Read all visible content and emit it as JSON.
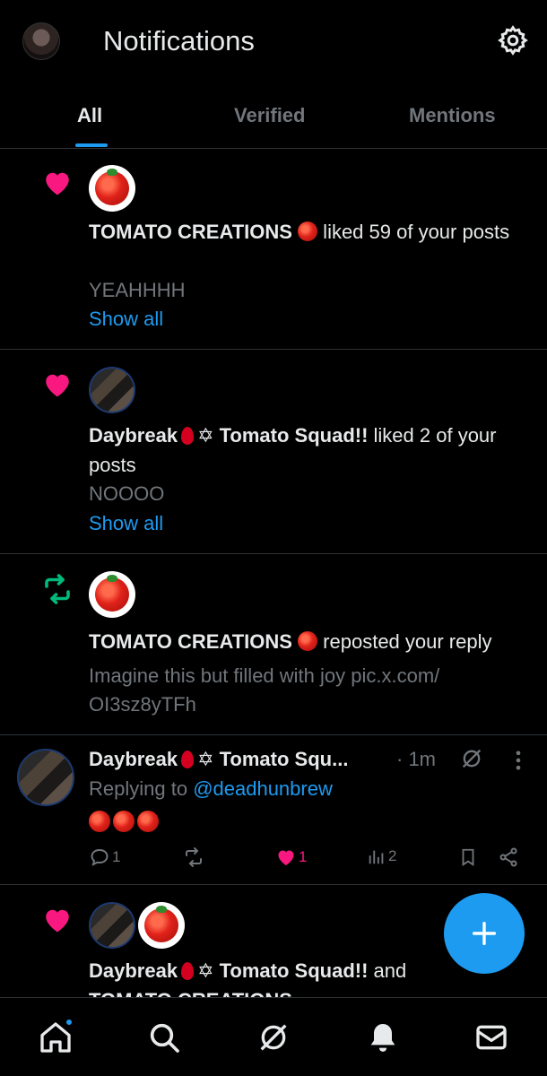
{
  "header": {
    "title": "Notifications",
    "avatar_icon": "profile-avatar",
    "settings_icon": "gear-icon"
  },
  "tabs": [
    {
      "label": "All",
      "active": true
    },
    {
      "label": "Verified"
    },
    {
      "label": "Mentions"
    }
  ],
  "notifications": [
    {
      "type": "like",
      "actor": "TOMATO CREATIONS",
      "action": " liked 59 of your posts",
      "preview": "YEAHHHH",
      "link": "Show all"
    },
    {
      "type": "like",
      "actor_a": "Daybreak",
      "actor_b": "Tomato Squad!!",
      "action": " liked 2 of your posts",
      "preview": "NOOOO",
      "link": "Show all"
    },
    {
      "type": "repost",
      "actor": "TOMATO CREATIONS",
      "action": " reposted your reply",
      "preview": "Imagine this but filled with joy pic.x.com/ OI3sz8yTFh"
    }
  ],
  "post": {
    "name_a": "Daybreak",
    "name_b": "Tomato Squ...",
    "time": "· 1m",
    "replying_prefix": "Replying to ",
    "replying_handle": "@deadhunbrew",
    "emoji_count": 3,
    "actions": {
      "replies": "1",
      "reposts": "",
      "likes": "1",
      "views": "2"
    }
  },
  "notif5": {
    "actor_a": "Daybreak",
    "actor_b": "Tomato Squad!!",
    "conj": " and",
    "next": "TOMATO CREATIONS"
  },
  "colors": {
    "accent": "#1d9bf0",
    "like": "#f91880",
    "repost": "#00ba7c",
    "muted": "#71767b"
  },
  "nav": [
    "home-icon",
    "search-icon",
    "grok-icon",
    "bell-icon",
    "mail-icon"
  ]
}
